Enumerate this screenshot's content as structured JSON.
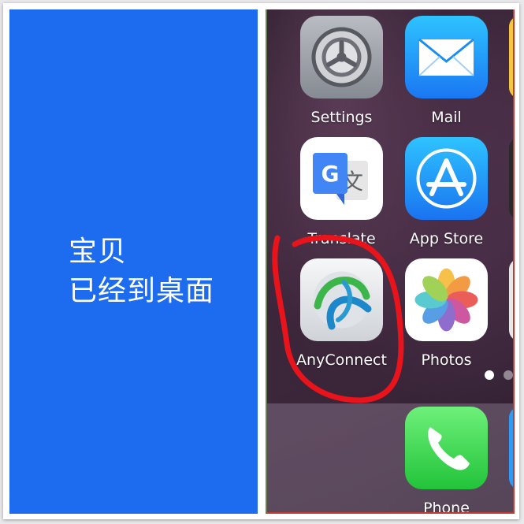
{
  "caption": {
    "line1": "宝贝",
    "line2": "已经到桌面"
  },
  "apps": {
    "settings": {
      "label": "Settings",
      "icon": "settings-gear-icon"
    },
    "mail": {
      "label": "Mail",
      "icon": "mail-envelope-icon"
    },
    "translate": {
      "label": "Translate",
      "icon": "google-translate-icon"
    },
    "app_store": {
      "label": "App Store",
      "icon": "app-store-icon"
    },
    "anyconnect": {
      "label": "AnyConnect",
      "icon": "anyconnect-icon"
    },
    "photos": {
      "label": "Photos",
      "icon": "photos-flower-icon"
    },
    "phone": {
      "label": "Phone",
      "icon": "phone-handset-icon"
    }
  },
  "colors": {
    "left_panel": "#1d6cf0",
    "annotation": "#e8131b"
  }
}
